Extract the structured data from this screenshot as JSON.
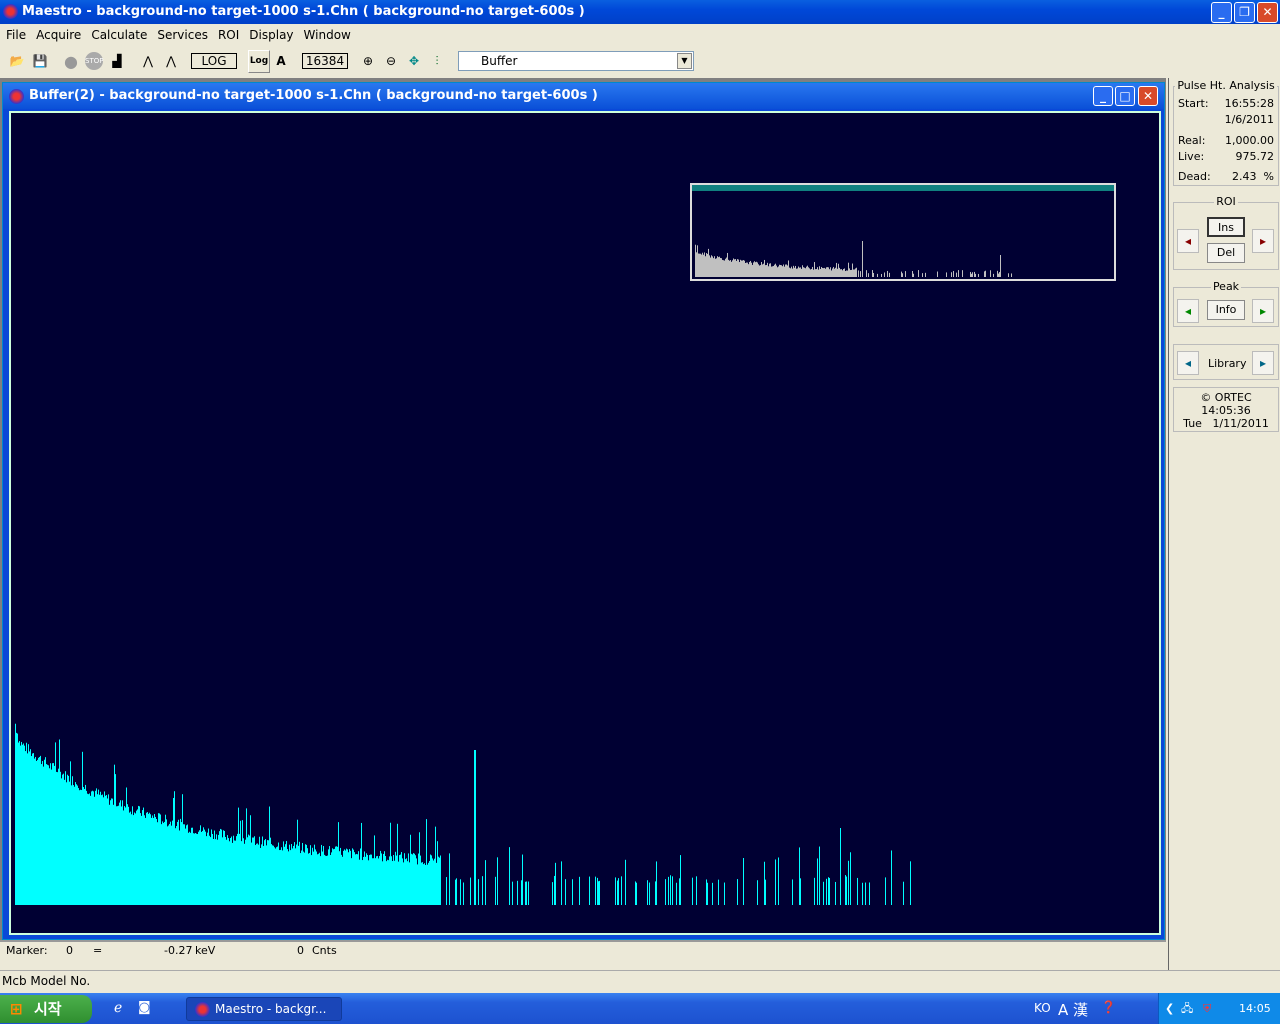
{
  "app": {
    "title": "Maestro - background-no target-1000 s-1.Chn ( background-no target-600s )"
  },
  "menu": [
    "File",
    "Acquire",
    "Calculate",
    "Services",
    "ROI",
    "Display",
    "Window"
  ],
  "toolbar": {
    "log_label": "LOG",
    "log_toggle": "Log",
    "auto_label": "A",
    "channels": "16384",
    "buffer_select": "Buffer"
  },
  "child": {
    "title": "Buffer(2) - background-no target-1000 s-1.Chn ( background-no target-600s )"
  },
  "marker": {
    "label": "Marker:",
    "channel": "0",
    "equals": "=",
    "energy": "-0.27",
    "energy_unit": "keV",
    "counts": "0",
    "counts_unit": "Cnts"
  },
  "status": {
    "text": "Mcb Model No."
  },
  "panel": {
    "pha_title": "Pulse Ht. Analysis",
    "start_label": "Start:",
    "start_time": "16:55:28",
    "start_date": "1/6/2011",
    "real_label": "Real:",
    "real": "1,000.00",
    "live_label": "Live:",
    "live": "975.72",
    "dead_label": "Dead:",
    "dead": "2.43",
    "dead_unit": "%",
    "roi_title": "ROI",
    "ins": "Ins",
    "del": "Del",
    "peak_title": "Peak",
    "info": "Info",
    "library": "Library",
    "ortec": "© ORTEC",
    "clock_time": "14:05:36",
    "clock_day": "Tue",
    "clock_date": "1/11/2011"
  },
  "taskbar": {
    "start": "시작",
    "task": "Maestro - backgr...",
    "ime": "KO",
    "ime2": "A 漢",
    "clock": "14:05"
  },
  "colors": {
    "spectrum": "#00ffff",
    "plot_bg": "#000033",
    "inset_spectrum": "#c0c0c0"
  }
}
